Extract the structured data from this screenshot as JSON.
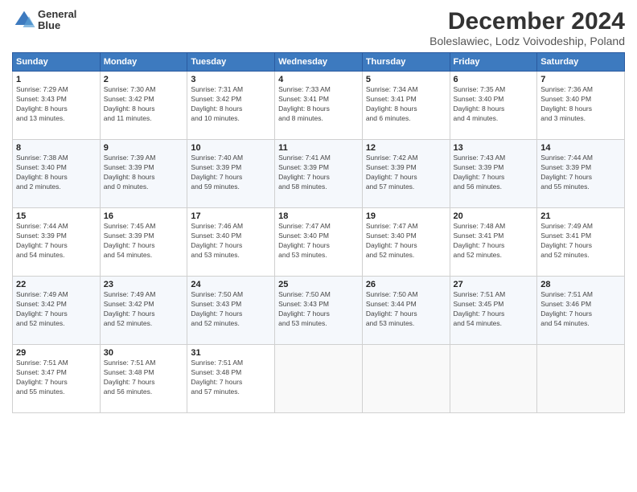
{
  "header": {
    "logo_line1": "General",
    "logo_line2": "Blue",
    "title": "December 2024",
    "subtitle": "Boleslawiec, Lodz Voivodeship, Poland"
  },
  "weekdays": [
    "Sunday",
    "Monday",
    "Tuesday",
    "Wednesday",
    "Thursday",
    "Friday",
    "Saturday"
  ],
  "weeks": [
    [
      {
        "day": 1,
        "info": "Sunrise: 7:29 AM\nSunset: 3:43 PM\nDaylight: 8 hours\nand 13 minutes."
      },
      {
        "day": 2,
        "info": "Sunrise: 7:30 AM\nSunset: 3:42 PM\nDaylight: 8 hours\nand 11 minutes."
      },
      {
        "day": 3,
        "info": "Sunrise: 7:31 AM\nSunset: 3:42 PM\nDaylight: 8 hours\nand 10 minutes."
      },
      {
        "day": 4,
        "info": "Sunrise: 7:33 AM\nSunset: 3:41 PM\nDaylight: 8 hours\nand 8 minutes."
      },
      {
        "day": 5,
        "info": "Sunrise: 7:34 AM\nSunset: 3:41 PM\nDaylight: 8 hours\nand 6 minutes."
      },
      {
        "day": 6,
        "info": "Sunrise: 7:35 AM\nSunset: 3:40 PM\nDaylight: 8 hours\nand 4 minutes."
      },
      {
        "day": 7,
        "info": "Sunrise: 7:36 AM\nSunset: 3:40 PM\nDaylight: 8 hours\nand 3 minutes."
      }
    ],
    [
      {
        "day": 8,
        "info": "Sunrise: 7:38 AM\nSunset: 3:40 PM\nDaylight: 8 hours\nand 2 minutes."
      },
      {
        "day": 9,
        "info": "Sunrise: 7:39 AM\nSunset: 3:39 PM\nDaylight: 8 hours\nand 0 minutes."
      },
      {
        "day": 10,
        "info": "Sunrise: 7:40 AM\nSunset: 3:39 PM\nDaylight: 7 hours\nand 59 minutes."
      },
      {
        "day": 11,
        "info": "Sunrise: 7:41 AM\nSunset: 3:39 PM\nDaylight: 7 hours\nand 58 minutes."
      },
      {
        "day": 12,
        "info": "Sunrise: 7:42 AM\nSunset: 3:39 PM\nDaylight: 7 hours\nand 57 minutes."
      },
      {
        "day": 13,
        "info": "Sunrise: 7:43 AM\nSunset: 3:39 PM\nDaylight: 7 hours\nand 56 minutes."
      },
      {
        "day": 14,
        "info": "Sunrise: 7:44 AM\nSunset: 3:39 PM\nDaylight: 7 hours\nand 55 minutes."
      }
    ],
    [
      {
        "day": 15,
        "info": "Sunrise: 7:44 AM\nSunset: 3:39 PM\nDaylight: 7 hours\nand 54 minutes."
      },
      {
        "day": 16,
        "info": "Sunrise: 7:45 AM\nSunset: 3:39 PM\nDaylight: 7 hours\nand 54 minutes."
      },
      {
        "day": 17,
        "info": "Sunrise: 7:46 AM\nSunset: 3:40 PM\nDaylight: 7 hours\nand 53 minutes."
      },
      {
        "day": 18,
        "info": "Sunrise: 7:47 AM\nSunset: 3:40 PM\nDaylight: 7 hours\nand 53 minutes."
      },
      {
        "day": 19,
        "info": "Sunrise: 7:47 AM\nSunset: 3:40 PM\nDaylight: 7 hours\nand 52 minutes."
      },
      {
        "day": 20,
        "info": "Sunrise: 7:48 AM\nSunset: 3:41 PM\nDaylight: 7 hours\nand 52 minutes."
      },
      {
        "day": 21,
        "info": "Sunrise: 7:49 AM\nSunset: 3:41 PM\nDaylight: 7 hours\nand 52 minutes."
      }
    ],
    [
      {
        "day": 22,
        "info": "Sunrise: 7:49 AM\nSunset: 3:42 PM\nDaylight: 7 hours\nand 52 minutes."
      },
      {
        "day": 23,
        "info": "Sunrise: 7:49 AM\nSunset: 3:42 PM\nDaylight: 7 hours\nand 52 minutes."
      },
      {
        "day": 24,
        "info": "Sunrise: 7:50 AM\nSunset: 3:43 PM\nDaylight: 7 hours\nand 52 minutes."
      },
      {
        "day": 25,
        "info": "Sunrise: 7:50 AM\nSunset: 3:43 PM\nDaylight: 7 hours\nand 53 minutes."
      },
      {
        "day": 26,
        "info": "Sunrise: 7:50 AM\nSunset: 3:44 PM\nDaylight: 7 hours\nand 53 minutes."
      },
      {
        "day": 27,
        "info": "Sunrise: 7:51 AM\nSunset: 3:45 PM\nDaylight: 7 hours\nand 54 minutes."
      },
      {
        "day": 28,
        "info": "Sunrise: 7:51 AM\nSunset: 3:46 PM\nDaylight: 7 hours\nand 54 minutes."
      }
    ],
    [
      {
        "day": 29,
        "info": "Sunrise: 7:51 AM\nSunset: 3:47 PM\nDaylight: 7 hours\nand 55 minutes."
      },
      {
        "day": 30,
        "info": "Sunrise: 7:51 AM\nSunset: 3:48 PM\nDaylight: 7 hours\nand 56 minutes."
      },
      {
        "day": 31,
        "info": "Sunrise: 7:51 AM\nSunset: 3:48 PM\nDaylight: 7 hours\nand 57 minutes."
      },
      null,
      null,
      null,
      null
    ]
  ]
}
